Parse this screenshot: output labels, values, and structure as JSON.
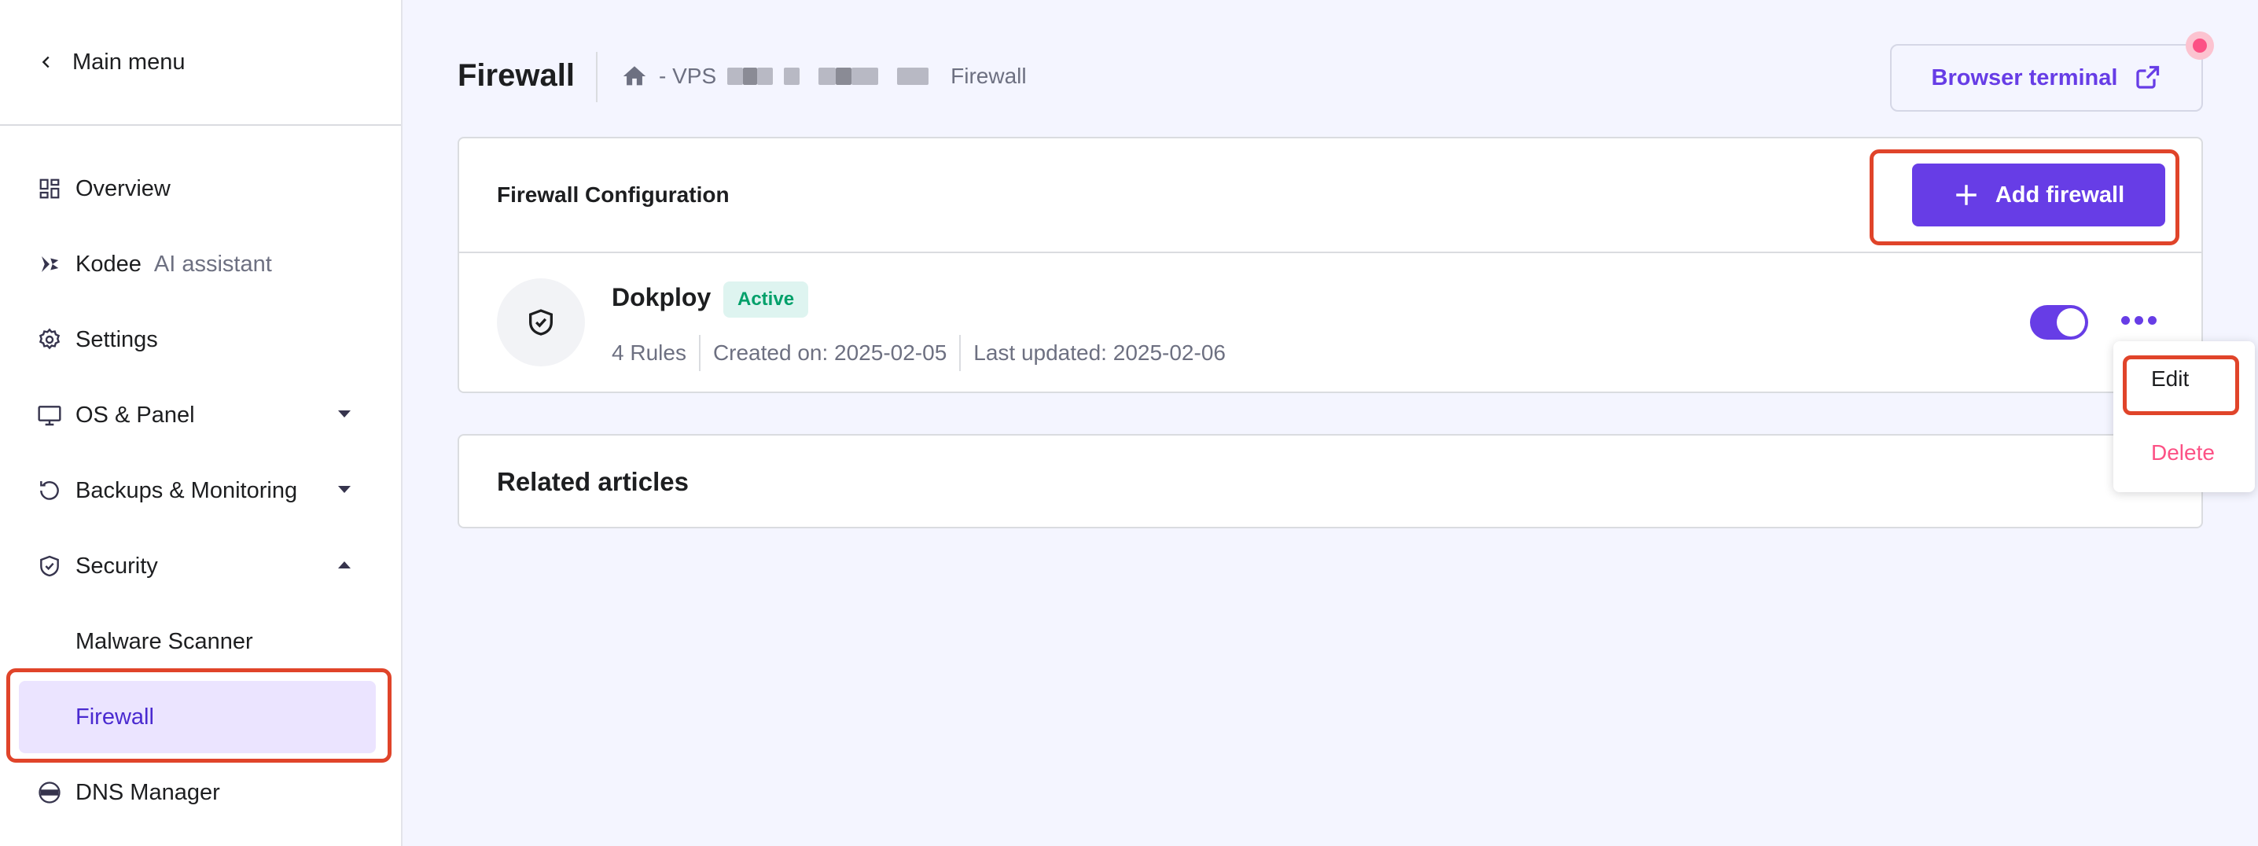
{
  "sidebar": {
    "main_menu": "Main menu",
    "items": [
      {
        "label": "Overview",
        "icon": "overview-icon"
      },
      {
        "label": "Kodee",
        "sub": "AI assistant",
        "icon": "kodee-icon"
      },
      {
        "label": "Settings",
        "icon": "gear-icon"
      },
      {
        "label": "OS & Panel",
        "icon": "monitor-icon"
      },
      {
        "label": "Backups & Monitoring",
        "icon": "backup-icon"
      },
      {
        "label": "Security",
        "icon": "shield-icon"
      },
      {
        "label": "Malware Scanner"
      },
      {
        "label": "Firewall"
      },
      {
        "label": "DNS Manager",
        "icon": "dns-icon"
      }
    ]
  },
  "header": {
    "title": "Firewall",
    "breadcrumb_prefix": "- VPS",
    "breadcrumb_current": "Firewall",
    "terminal_label": "Browser terminal"
  },
  "firewall_card": {
    "heading": "Firewall Configuration",
    "add_label": "Add firewall",
    "entry": {
      "name": "Dokploy",
      "status": "Active",
      "rules": "4 Rules",
      "created": "Created on: 2025-02-05",
      "updated": "Last updated: 2025-02-06",
      "enabled": true
    }
  },
  "related": {
    "heading": "Related articles"
  },
  "menu": {
    "edit": "Edit",
    "delete": "Delete"
  },
  "colors": {
    "accent": "#673de6",
    "highlight": "#e0442a",
    "active_badge": "#00a06a",
    "danger": "#fc5185"
  }
}
